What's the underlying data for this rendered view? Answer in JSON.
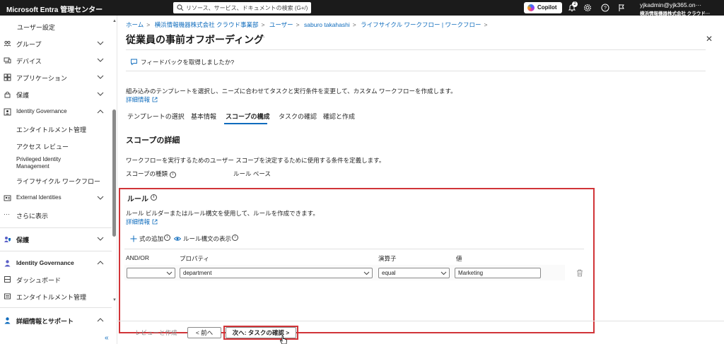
{
  "topbar": {
    "brand": "Microsoft Entra 管理センター",
    "search_placeholder": "リソース、サービス、ドキュメントの検索 (G+/)",
    "copilot_label": "Copilot",
    "notification_count": "2",
    "user": "yjkadmin@yjk365.on···",
    "tenant": "横浜情報機器株式会社 クラウド···"
  },
  "sidebar": {
    "items": [
      {
        "label": "ユーザー設定"
      },
      {
        "label": "グループ"
      },
      {
        "label": "デバイス"
      },
      {
        "label": "アプリケーション"
      },
      {
        "label": "保護"
      },
      {
        "label": "Identity Governance"
      },
      {
        "label": "エンタイトルメント管理"
      },
      {
        "label": "アクセス レビュー"
      },
      {
        "label": "Privileged Identity Management"
      },
      {
        "label": "ライフサイクル ワークフロー"
      },
      {
        "label": "External Identities"
      },
      {
        "label": "さらに表示"
      },
      {
        "label": "保護"
      },
      {
        "label": "Identity Governance"
      },
      {
        "label": "ダッシュボード"
      },
      {
        "label": "エンタイトルメント管理"
      },
      {
        "label": "詳細情報とサポート"
      }
    ],
    "collapse_label": "«"
  },
  "breadcrumb": [
    "ホーム",
    "横浜情報機器株式会社 クラウド事業部",
    "ユーザー",
    "saburo takahashi",
    "ライフサイクル ワークフロー | ワークフロー"
  ],
  "breadcrumb_trailing": ">",
  "page": {
    "title": "従業員の事前オフボーディング",
    "more": "···",
    "close": "✕",
    "feedback": "フィードバックを取得しましたか?",
    "description": "組み込みのテンプレートを選択し、ニーズに合わせてタスクと実行条件を変更して、カスタム ワークフローを作成します。",
    "learn_more": "詳細情報"
  },
  "tabs": [
    "テンプレートの選択",
    "基本情報",
    "スコープの構成",
    "タスクの確認",
    "確認と作成"
  ],
  "scope": {
    "heading": "スコープの詳細",
    "description": "ワークフローを実行するためのユーザー スコープを決定するために使用する条件を定義します。",
    "type_label": "スコープの種類",
    "type_value": "ルール ベース"
  },
  "rules": {
    "title": "ルール",
    "description": "ルール ビルダーまたはルール構文を使用して、ルールを作成できます。",
    "learn_more": "詳細情報",
    "add_expression": "式の追加",
    "show_syntax": "ルール構文の表示",
    "columns": {
      "andor": "AND/OR",
      "property": "プロパティ",
      "operator": "演算子",
      "value": "値"
    },
    "row": {
      "andor": "",
      "property": "department",
      "operator": "equal",
      "value": "Marketing"
    }
  },
  "footer": {
    "review_create": "レビューと作成",
    "prev": "< 前へ",
    "next": "次へ: タスクの確認 >"
  },
  "colors": {
    "accent": "#0f6cbd",
    "highlight": "#d13438",
    "topbar": "#1b1b1b"
  }
}
